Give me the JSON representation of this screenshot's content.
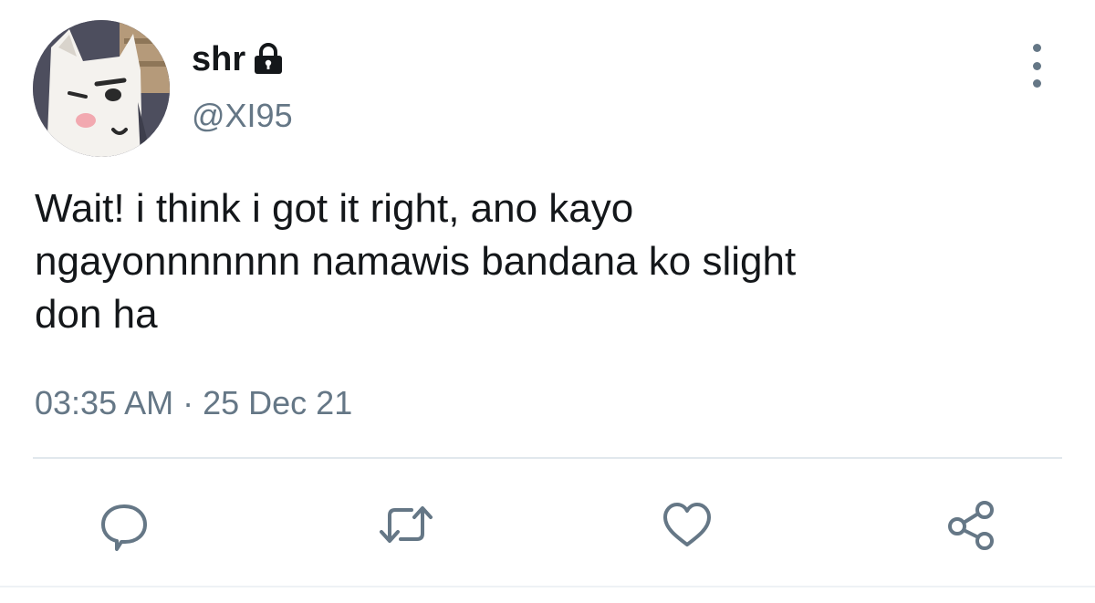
{
  "user": {
    "display_name": "shr",
    "handle": "@XI95",
    "protected_icon": "lock-icon",
    "avatar_icon": "cat-mascot-avatar"
  },
  "tweet": {
    "text": "Wait! i think i got it right, ano kayo\nngayonnnnnnn namawis bandana ko slight\ndon ha",
    "time": "03:35 AM",
    "separator": "·",
    "date": "25 Dec 21"
  },
  "actions": [
    {
      "name": "reply",
      "icon": "reply-icon"
    },
    {
      "name": "retweet",
      "icon": "retweet-icon"
    },
    {
      "name": "like",
      "icon": "heart-icon"
    },
    {
      "name": "share",
      "icon": "share-icon"
    }
  ],
  "more_icon": "more-vertical-icon",
  "colors": {
    "text": "#14171a",
    "secondary": "#657786",
    "divider": "#e1e8ed"
  }
}
